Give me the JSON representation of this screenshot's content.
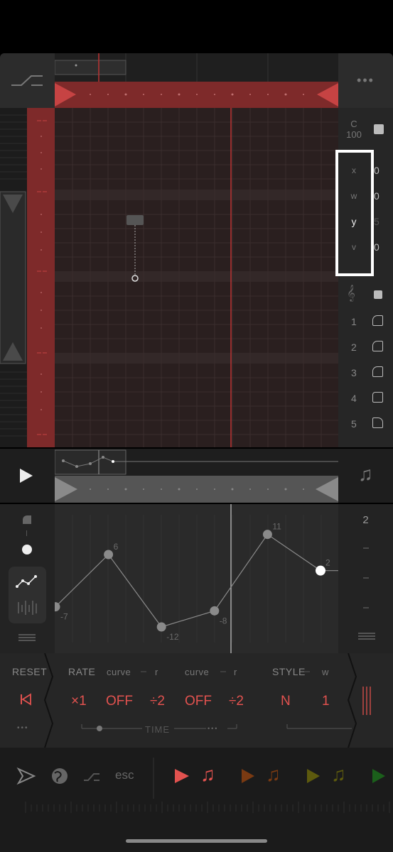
{
  "app": {
    "title": ""
  },
  "top_right_menu_label": "•••",
  "side_panel": {
    "note_label": "C",
    "note_value": "100",
    "params": [
      {
        "name": "x",
        "value": "0"
      },
      {
        "name": "w",
        "value": "0"
      },
      {
        "name": "y",
        "value": "5"
      },
      {
        "name": "v",
        "value": "0"
      }
    ],
    "tracks": [
      "1",
      "2",
      "3",
      "4",
      "5"
    ]
  },
  "automation": {
    "top_value": "2",
    "point_labels": [
      "-7",
      "6",
      "-12",
      "-8",
      "11",
      "2"
    ],
    "points": [
      -7,
      6,
      -12,
      -8,
      11,
      2
    ],
    "range": [
      -15,
      15
    ]
  },
  "controls": {
    "reset": "RESET",
    "rate": "RATE",
    "curve1": "curve",
    "r1": "r",
    "curve2": "curve",
    "r2": "r",
    "style": "STYLE",
    "w": "w",
    "rate_value": "×1",
    "curve1_value": "OFF",
    "div1_value": "÷2",
    "curve2_value": "OFF",
    "div2_value": "÷2",
    "style_value": "N",
    "w_value": "1",
    "time_label": "TIME",
    "dots": "•••"
  },
  "toolbar": {
    "esc": "esc"
  },
  "colors": {
    "accent_red": "#e2524f",
    "orange": "#8a4a1a",
    "olive": "#6f6a12",
    "green": "#1f6e1f"
  }
}
